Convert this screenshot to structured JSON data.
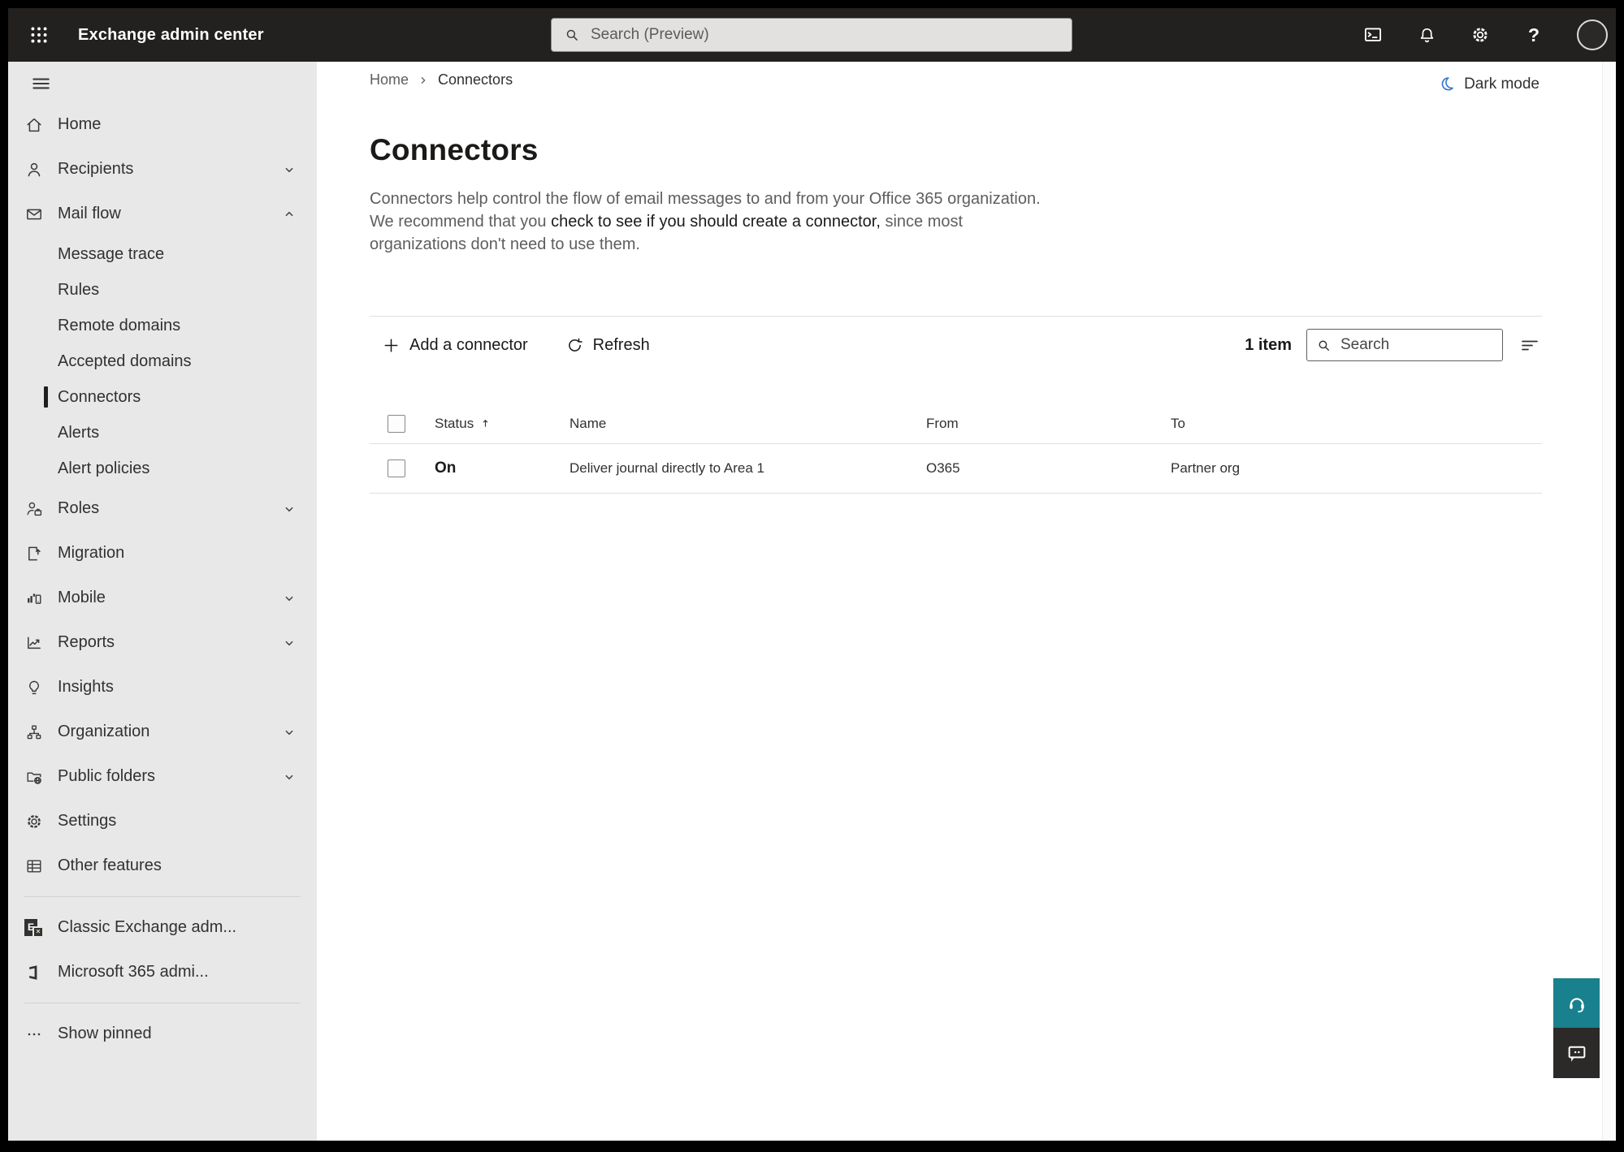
{
  "topbar": {
    "app_title": "Exchange admin center",
    "search_placeholder": "Search (Preview)"
  },
  "breadcrumb": {
    "items": [
      "Home",
      "Connectors"
    ]
  },
  "dark_mode_label": "Dark mode",
  "page": {
    "title": "Connectors",
    "description": {
      "before": "Connectors help control the flow of email messages to and from your Office 365 organization. We recommend that you ",
      "emphasis": "check to see if you should create a connector,",
      "after": " since most organizations don't need to use them."
    }
  },
  "toolbar": {
    "add_label": "Add a connector",
    "refresh_label": "Refresh",
    "items_count": "1 item",
    "search_placeholder": "Search"
  },
  "table": {
    "columns": [
      "Status",
      "Name",
      "From",
      "To"
    ],
    "sorted_by": "Status",
    "sort_direction": "ascending",
    "rows": [
      {
        "status": "On",
        "name": "Deliver journal directly to Area 1",
        "from": "O365",
        "to": "Partner org"
      }
    ]
  },
  "sidebar": {
    "items": [
      {
        "label": "Home",
        "icon": "home-icon"
      },
      {
        "label": "Recipients",
        "icon": "person-icon",
        "chevron": "down"
      },
      {
        "label": "Mail flow",
        "icon": "mail-icon",
        "chevron": "up",
        "expanded": true
      },
      {
        "label": "Message trace",
        "type": "sub"
      },
      {
        "label": "Rules",
        "type": "sub"
      },
      {
        "label": "Remote domains",
        "type": "sub"
      },
      {
        "label": "Accepted domains",
        "type": "sub"
      },
      {
        "label": "Connectors",
        "type": "sub",
        "selected": true
      },
      {
        "label": "Alerts",
        "type": "sub"
      },
      {
        "label": "Alert policies",
        "type": "sub"
      },
      {
        "label": "Roles",
        "icon": "roles-icon",
        "chevron": "down"
      },
      {
        "label": "Migration",
        "icon": "migration-icon"
      },
      {
        "label": "Mobile",
        "icon": "mobile-icon",
        "chevron": "down"
      },
      {
        "label": "Reports",
        "icon": "reports-icon",
        "chevron": "down"
      },
      {
        "label": "Insights",
        "icon": "lightbulb-icon"
      },
      {
        "label": "Organization",
        "icon": "org-chart-icon",
        "chevron": "down"
      },
      {
        "label": "Public folders",
        "icon": "folder-globe-icon",
        "chevron": "down"
      },
      {
        "label": "Settings",
        "icon": "gear-icon"
      },
      {
        "label": "Other features",
        "icon": "table-icon"
      }
    ],
    "footer_items": [
      {
        "label": "Classic Exchange adm...",
        "icon": "exchange-logo"
      },
      {
        "label": "Microsoft 365 admi...",
        "icon": "microsoft-365-logo"
      }
    ],
    "show_pinned_label": "Show pinned",
    "exchange_logo_letter": "E",
    "exchange_logo_x": "✕"
  },
  "colors": {
    "topbar_bg": "#222120",
    "sidebar_bg": "#e9e8e8",
    "accent_teal": "#19808d",
    "feedback_dark": "#2b2a28",
    "moon_blue": "#3577c9",
    "selected_indicator": "#201f1e",
    "divider": "#e1e0de"
  }
}
